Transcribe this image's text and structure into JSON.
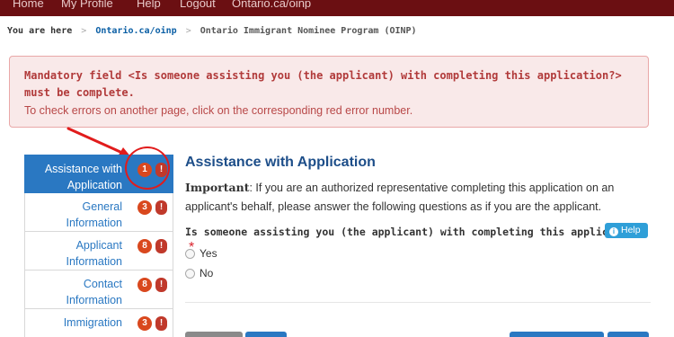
{
  "topnav": {
    "items": [
      "Home",
      "My Profile",
      "Help",
      "Logout",
      "Ontario.ca/oinp"
    ]
  },
  "breadcrumb": {
    "label": "You are here",
    "sep": ">",
    "link": "Ontario.ca/oinp",
    "current": "Ontario Immigrant Nominee Program (OINP)"
  },
  "error": {
    "title": "Mandatory field <Is someone assisting you (the applicant) with completing this application?> must be complete.",
    "hint": "To check errors on another page, click on the corresponding red error number."
  },
  "sidebar": {
    "items": [
      {
        "label": "Assistance with Application",
        "errors": "1",
        "active": true
      },
      {
        "label": "General Information",
        "errors": "3",
        "active": false
      },
      {
        "label": "Applicant Information",
        "errors": "8",
        "active": false
      },
      {
        "label": "Contact Information",
        "errors": "8",
        "active": false
      },
      {
        "label": "Immigration",
        "errors": "3",
        "active": false
      }
    ],
    "warn_glyph": "!"
  },
  "main": {
    "title": "Assistance with Application",
    "important_label": "Important",
    "important_text": ": If you are an authorized representative completing this application on an applicant's behalf, please answer the following questions as if you are the applicant.",
    "question": "Is someone assisting you (the applicant) with completing this application?",
    "required_mark": "*",
    "help_label": "Help",
    "info_glyph": "i",
    "options": [
      "Yes",
      "No"
    ]
  },
  "colors": {
    "topbar": "#6b0f12",
    "active_nav": "#2a78c2",
    "error_badge": "#d9481e",
    "annotation": "#e11c1c",
    "help_button": "#2f9fd8"
  }
}
